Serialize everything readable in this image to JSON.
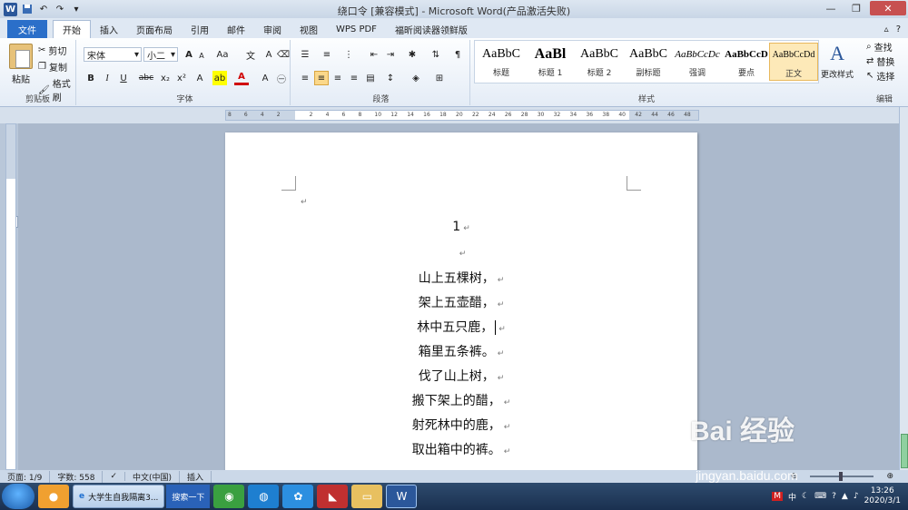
{
  "window": {
    "title": "绕口令 [兼容模式] - Microsoft Word(产品激活失败)",
    "app_logo": "W"
  },
  "tabs": [
    {
      "label": "文件"
    },
    {
      "label": "开始"
    },
    {
      "label": "插入"
    },
    {
      "label": "页面布局"
    },
    {
      "label": "引用"
    },
    {
      "label": "邮件"
    },
    {
      "label": "审阅"
    },
    {
      "label": "视图"
    },
    {
      "label": "WPS PDF"
    },
    {
      "label": "福昕阅读器领鲜版"
    }
  ],
  "clipboard": {
    "paste": "粘贴",
    "cut": "剪切",
    "copy": "复制",
    "format_painter": "格式刷",
    "group": "剪贴板"
  },
  "font": {
    "name": "宋体",
    "size": "小二",
    "group": "字体",
    "bold": "B",
    "italic": "I",
    "underline": "U",
    "strike": "abc",
    "sub": "x₂",
    "sup": "x²",
    "grow": "A",
    "shrink": "A",
    "case": "Aa",
    "color": "A"
  },
  "paragraph": {
    "group": "段落"
  },
  "styles": {
    "group": "样式",
    "items": [
      {
        "preview": "AaBbC",
        "name": "标题"
      },
      {
        "preview": "AaBl",
        "name": "标题 1"
      },
      {
        "preview": "AaBbC",
        "name": "标题 2"
      },
      {
        "preview": "AaBbC",
        "name": "副标题"
      },
      {
        "preview": "AaBbCcDc",
        "name": "强调"
      },
      {
        "preview": "AaBbCcD",
        "name": "要点"
      },
      {
        "preview": "AaBbCcDd",
        "name": "正文"
      }
    ],
    "change_styles": "更改样式"
  },
  "editing": {
    "group": "编辑",
    "find": "查找",
    "replace": "替换",
    "select": "选择"
  },
  "ruler_numbers": [
    "8",
    "6",
    "4",
    "2",
    "",
    "2",
    "4",
    "6",
    "8",
    "10",
    "12",
    "14",
    "16",
    "18",
    "20",
    "22",
    "24",
    "26",
    "28",
    "30",
    "32",
    "34",
    "36",
    "38",
    "40",
    "42",
    "44",
    "46",
    "48"
  ],
  "document": {
    "page_number": "1",
    "lines": [
      "山上五棵树，",
      "架上五壶醋，",
      "林中五只鹿，",
      "箱里五条裤。",
      "伐了山上树，",
      "搬下架上的醋，",
      "射死林中的鹿，",
      "取出箱中的裤。"
    ],
    "para_mark": "↵"
  },
  "status": {
    "page": "页面: 1/9",
    "words": "字数: 558",
    "language": "中文(中国)",
    "mode": "插入"
  },
  "taskbar": {
    "task_label": "大学生自我隔离3...",
    "search_label": "搜索一下",
    "ime": "中",
    "time": "13:26",
    "date": "2020/3/1"
  },
  "watermark": {
    "logo_text": "Bai 经验",
    "url": "jingyan.baidu.com"
  }
}
